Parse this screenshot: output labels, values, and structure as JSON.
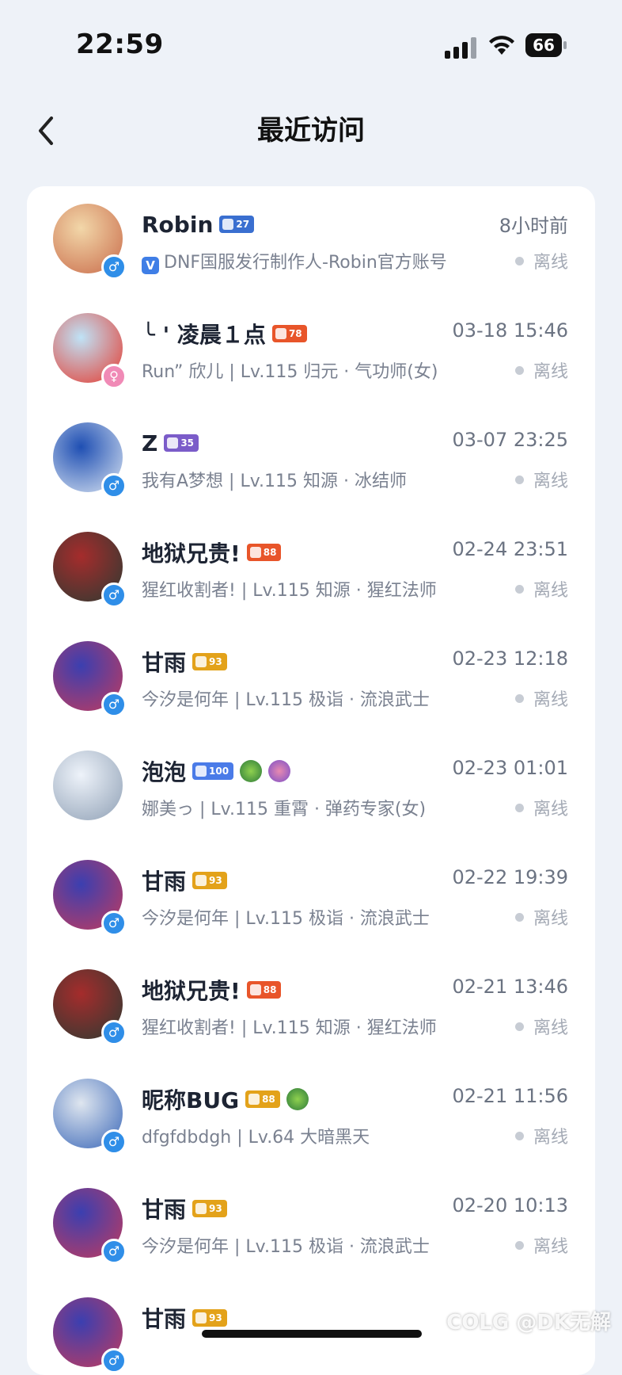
{
  "status_bar": {
    "time": "22:59",
    "battery": "66"
  },
  "header": {
    "title": "最近访问"
  },
  "rows": [
    {
      "name": "Robin",
      "badges": [
        {
          "text": "27",
          "color": "blue"
        }
      ],
      "time": "8小时前",
      "subtitle": "DNF国服发行制作人-Robin官方账号",
      "verified": true,
      "status": "离线",
      "gender": "♂",
      "avatar_colors": [
        "#f2d7a9",
        "#c96b4a"
      ]
    },
    {
      "name": "╰ ' 凌晨１点",
      "badges": [
        {
          "text": "78",
          "color": "orange"
        }
      ],
      "time": "03-18 15:46",
      "subtitle": "Run” 欣儿 | Lv.115 归元 · 气功师(女)",
      "status": "离线",
      "gender": "♀",
      "gender_female": true,
      "avatar_colors": [
        "#bfe3f7",
        "#e53a2f"
      ]
    },
    {
      "name": "Z",
      "badges": [
        {
          "text": "35",
          "color": "purple"
        }
      ],
      "time": "03-07 23:25",
      "subtitle": "我有A梦想 | Lv.115 知源 · 冰结师",
      "status": "离线",
      "gender": "♂",
      "avatar_colors": [
        "#1f4fb3",
        "#d9e4f2"
      ]
    },
    {
      "name": "地狱兄贵!",
      "badges": [
        {
          "text": "88",
          "color": "orange"
        }
      ],
      "time": "02-24 23:51",
      "subtitle": "猩红收割者! | Lv.115 知源 · 猩红法师",
      "status": "离线",
      "gender": "♂",
      "avatar_colors": [
        "#a52c2c",
        "#2d3a32"
      ]
    },
    {
      "name": "甘雨",
      "badges": [
        {
          "text": "93",
          "color": "gold"
        }
      ],
      "time": "02-23 12:18",
      "subtitle": "今汐是何年 | Lv.115 极诣 · 流浪武士",
      "status": "离线",
      "gender": "♂",
      "avatar_colors": [
        "#3b3fb0",
        "#c23b5e"
      ]
    },
    {
      "name": "泡泡",
      "badges": [
        {
          "text": "100",
          "color": "crystal"
        }
      ],
      "extra_emblems": 2,
      "time": "02-23 01:01",
      "subtitle": "娜美っ | Lv.115 重霄 · 弹药专家(女)",
      "status": "离线",
      "gender": "",
      "avatar_colors": [
        "#eef3fa",
        "#8fa0b5"
      ]
    },
    {
      "name": "甘雨",
      "badges": [
        {
          "text": "93",
          "color": "gold"
        }
      ],
      "time": "02-22 19:39",
      "subtitle": "今汐是何年 | Lv.115 极诣 · 流浪武士",
      "status": "离线",
      "gender": "♂",
      "avatar_colors": [
        "#3b3fb0",
        "#c23b5e"
      ]
    },
    {
      "name": "地狱兄贵!",
      "badges": [
        {
          "text": "88",
          "color": "orange"
        }
      ],
      "time": "02-21 13:46",
      "subtitle": "猩红收割者! | Lv.115 知源 · 猩红法师",
      "status": "离线",
      "gender": "♂",
      "avatar_colors": [
        "#a52c2c",
        "#2d3a32"
      ]
    },
    {
      "name": "昵称BUG",
      "badges": [
        {
          "text": "88",
          "color": "gold"
        }
      ],
      "extra_emblems": 1,
      "time": "02-21 11:56",
      "subtitle": "dfgfdbdgh | Lv.64 大暗黑天",
      "status": "离线",
      "gender": "♂",
      "avatar_colors": [
        "#dfe6ef",
        "#3a67b8"
      ]
    },
    {
      "name": "甘雨",
      "badges": [
        {
          "text": "93",
          "color": "gold"
        }
      ],
      "time": "02-20 10:13",
      "subtitle": "今汐是何年 | Lv.115 极诣 · 流浪武士",
      "status": "离线",
      "gender": "♂",
      "avatar_colors": [
        "#3b3fb0",
        "#c23b5e"
      ]
    },
    {
      "name": "甘雨",
      "badges": [
        {
          "text": "93",
          "color": "gold"
        }
      ],
      "time": "",
      "subtitle": "",
      "status": "",
      "gender": "♂",
      "avatar_colors": [
        "#3b3fb0",
        "#c23b5e"
      ]
    }
  ],
  "watermark": "COLG @DK无解"
}
